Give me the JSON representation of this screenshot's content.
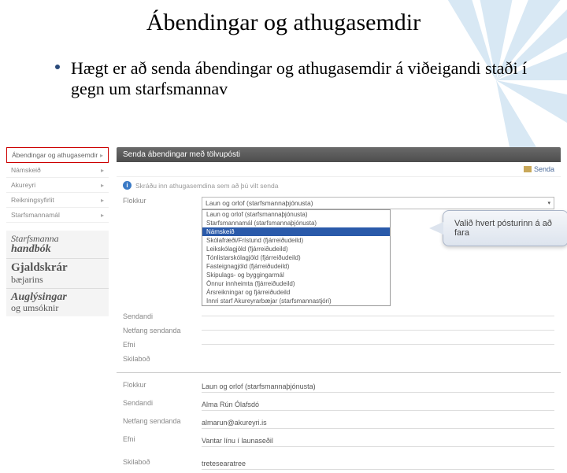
{
  "title": "Ábendingar og athugasemdir",
  "bullet": "Hægt er að senda ábendingar og athugasemdir á viðeigandi staði í gegn um starfsmannav",
  "sidebar": {
    "items": [
      {
        "label": "Ábendingar og athugasemdir",
        "active": true
      },
      {
        "label": "Námskeið",
        "active": false
      },
      {
        "label": "Akureyri",
        "active": false
      },
      {
        "label": "Reikningsyfirlit",
        "active": false
      },
      {
        "label": "Starfsmannamál",
        "active": false
      }
    ],
    "banners": [
      {
        "line1": "Starfsmanna",
        "line2": "handbók"
      },
      {
        "line1": "Gjaldskrár",
        "line2": "bæjarins"
      },
      {
        "line1": "Auglýsingar",
        "line2": "og umsóknir"
      }
    ]
  },
  "main": {
    "header": "Senda ábendingar með tölvupósti",
    "send_label": "Senda",
    "instruction": "Skráðu inn athugasemdina sem að þú vilt senda",
    "labels": {
      "flokkur": "Flokkur",
      "sendandi": "Sendandi",
      "netfang": "Netfang sendanda",
      "efni": "Efni",
      "skilabod": "Skilaboð"
    },
    "dropdown": {
      "selected": "Laun og orlof (starfsmannaþjónusta)",
      "options": [
        "Laun og orlof (starfsmannaþjónusta)",
        "Starfsmannamál (starfsmannaþjónusta)",
        "Námskeið",
        "Skólafræði/Frístund (fjárreiðudeild)",
        "Leikskólagjöld (fjárreiðudeild)",
        "Tónlistarskólagjöld (fjárreiðudeild)",
        "Fasteignagjöld (fjárreiðudeild)",
        "Skipulags- og byggingarmál",
        "Önnur innheimta (fjárreiðudeild)",
        "Ársreikningar og fjárreiðudeild",
        "Innri starf Akureyrarbæjar (starfsmannastjóri)"
      ],
      "highlighted_index": 2
    },
    "filled": {
      "flokkur": "Laun og orlof (starfsmannaþjónusta)",
      "sendandi": "Alma Rún Ólafsdó",
      "netfang": "almarun@akureyri.is",
      "efni": "Vantar línu í launaseðil",
      "skilabod": "tretesearatree"
    }
  },
  "callout": "Valið hvert pósturinn á að fara"
}
